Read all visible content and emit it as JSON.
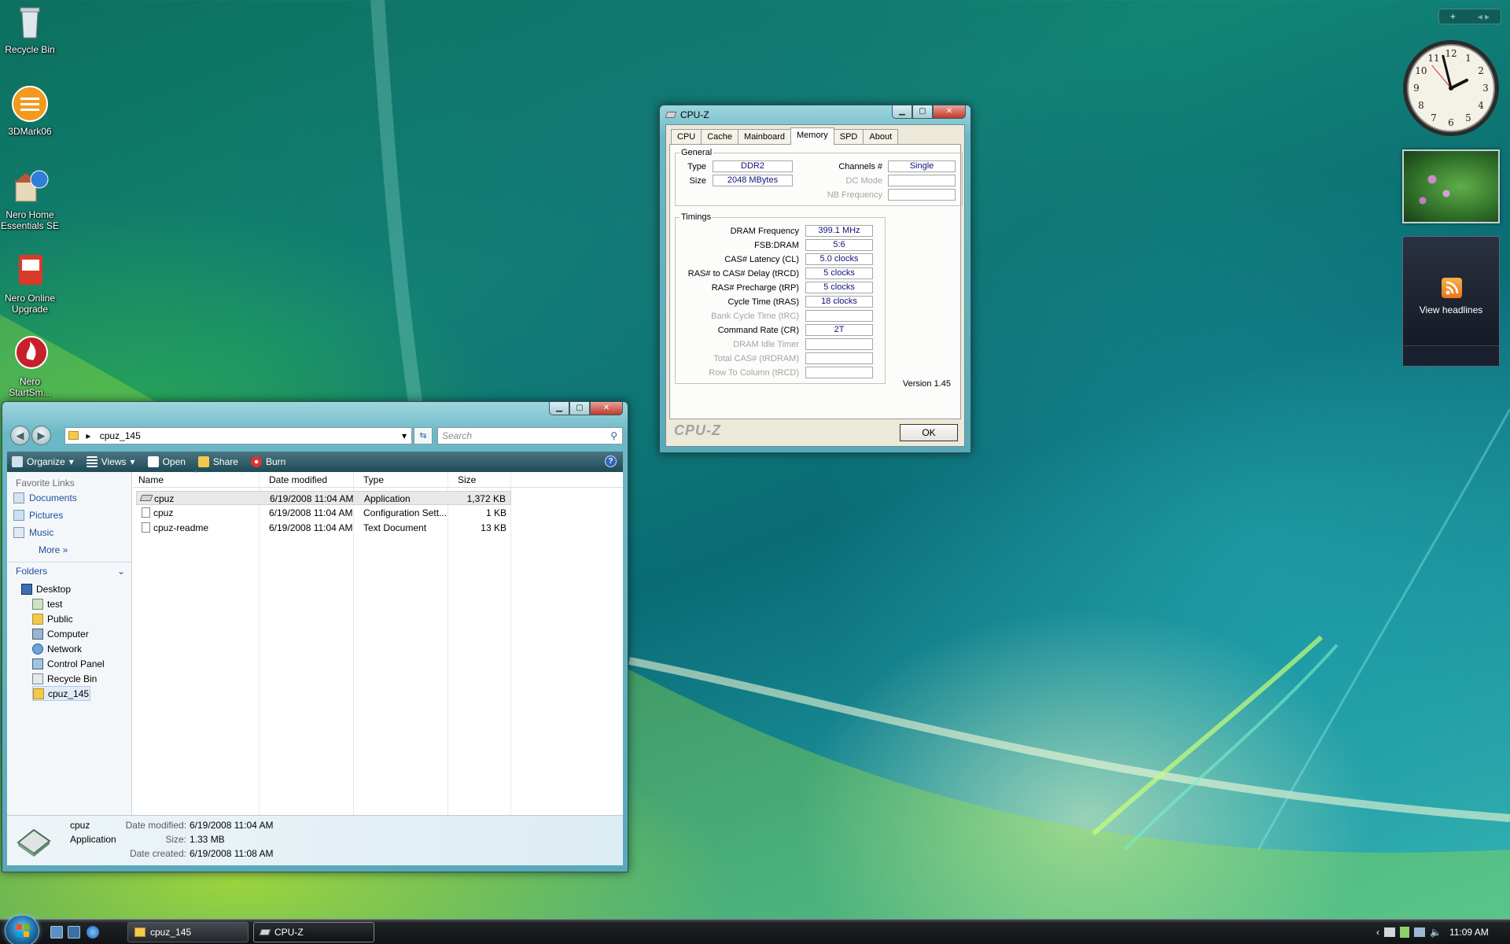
{
  "desktop": {
    "icons": [
      {
        "label": "Recycle Bin"
      },
      {
        "label": "3DMark06"
      },
      {
        "label": "Nero Home Essentials SE"
      },
      {
        "label": "Nero Online Upgrade"
      },
      {
        "label": "Nero StartSm..."
      }
    ]
  },
  "cpuz": {
    "title": "CPU-Z",
    "tabs": [
      "CPU",
      "Cache",
      "Mainboard",
      "Memory",
      "SPD",
      "About"
    ],
    "active_tab": "Memory",
    "general": {
      "legend": "General",
      "type_label": "Type",
      "type_value": "DDR2",
      "size_label": "Size",
      "size_value": "2048 MBytes",
      "channels_label": "Channels #",
      "channels_value": "Single",
      "dcmode_label": "DC Mode",
      "dcmode_value": "",
      "nbfreq_label": "NB Frequency",
      "nbfreq_value": ""
    },
    "timings": {
      "legend": "Timings",
      "rows": [
        {
          "label": "DRAM Frequency",
          "value": "399.1 MHz",
          "enabled": true
        },
        {
          "label": "FSB:DRAM",
          "value": "5:6",
          "enabled": true
        },
        {
          "label": "CAS# Latency (CL)",
          "value": "5.0 clocks",
          "enabled": true
        },
        {
          "label": "RAS# to CAS# Delay (tRCD)",
          "value": "5 clocks",
          "enabled": true
        },
        {
          "label": "RAS# Precharge (tRP)",
          "value": "5 clocks",
          "enabled": true
        },
        {
          "label": "Cycle Time (tRAS)",
          "value": "18 clocks",
          "enabled": true
        },
        {
          "label": "Bank Cycle Time (tRC)",
          "value": "",
          "enabled": false
        },
        {
          "label": "Command Rate (CR)",
          "value": "2T",
          "enabled": true
        },
        {
          "label": "DRAM Idle Timer",
          "value": "",
          "enabled": false
        },
        {
          "label": "Total CAS# (tRDRAM)",
          "value": "",
          "enabled": false
        },
        {
          "label": "Row To Column (tRCD)",
          "value": "",
          "enabled": false
        }
      ]
    },
    "version": "Version 1.45",
    "logo": "CPU-Z",
    "ok_label": "OK"
  },
  "explorer": {
    "address": "cpuz_145",
    "search_placeholder": "Search",
    "toolbar": {
      "organize": "Organize",
      "views": "Views",
      "open": "Open",
      "share": "Share",
      "burn": "Burn",
      "help": "?"
    },
    "favorite_links_title": "Favorite Links",
    "favorite_links": [
      "Documents",
      "Pictures",
      "Music",
      "More »"
    ],
    "folders_title": "Folders",
    "tree": [
      "Desktop",
      "test",
      "Public",
      "Computer",
      "Network",
      "Control Panel",
      "Recycle Bin",
      "cpuz_145"
    ],
    "columns": [
      "Name",
      "Date modified",
      "Type",
      "Size"
    ],
    "files": [
      {
        "name": "cpuz",
        "date": "6/19/2008 11:04 AM",
        "type": "Application",
        "size": "1,372 KB"
      },
      {
        "name": "cpuz",
        "date": "6/19/2008 11:04 AM",
        "type": "Configuration Sett...",
        "size": "1 KB"
      },
      {
        "name": "cpuz-readme",
        "date": "6/19/2008 11:04 AM",
        "type": "Text Document",
        "size": "13 KB"
      }
    ],
    "details": {
      "name": "cpuz",
      "kind": "Application",
      "modified_label": "Date modified:",
      "modified": "6/19/2008 11:04 AM",
      "size_label": "Size:",
      "size": "1.33 MB",
      "created_label": "Date created:",
      "created": "6/19/2008 11:08 AM"
    }
  },
  "sidebar": {
    "top_plus": "+",
    "top_nav": "◂ ▸",
    "feeds_label": "View headlines"
  },
  "taskbar": {
    "buttons": [
      {
        "label": "cpuz_145"
      },
      {
        "label": "CPU-Z"
      }
    ],
    "clock": "11:09 AM"
  },
  "colors": {
    "accent": "#10107a",
    "link": "#1e4e9c"
  }
}
